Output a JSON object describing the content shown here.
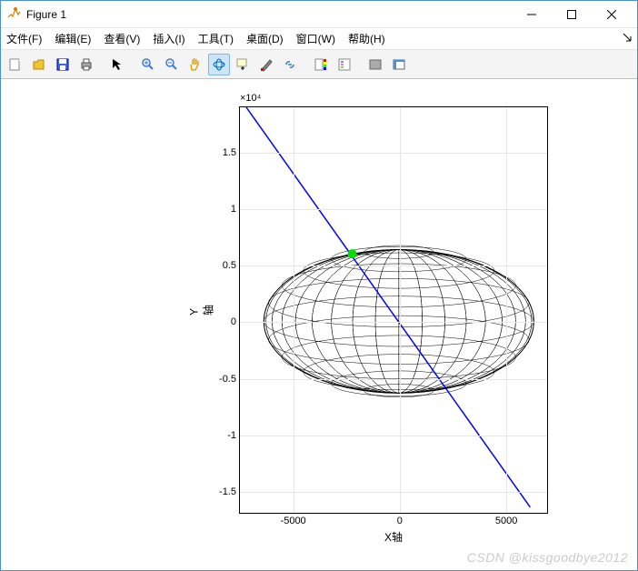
{
  "window": {
    "title": "Figure 1",
    "min_tooltip": "Minimize",
    "max_tooltip": "Maximize",
    "close_tooltip": "Close"
  },
  "menu": {
    "file": "文件(F)",
    "edit": "编辑(E)",
    "view": "查看(V)",
    "insert": "插入(I)",
    "tools": "工具(T)",
    "desktop": "桌面(D)",
    "window": "窗口(W)",
    "help": "帮助(H)"
  },
  "toolbar": {
    "new": "new-figure",
    "open": "open",
    "save": "save",
    "print": "print",
    "pointer": "edit-plot",
    "zoom_in": "zoom-in",
    "zoom_out": "zoom-out",
    "pan": "pan",
    "rotate3d": "rotate-3d",
    "datacursor": "data-cursor",
    "brush": "brush",
    "link": "link",
    "colorbar": "insert-colorbar",
    "legend": "insert-legend",
    "hide": "hide-plot-tools",
    "show": "show-plot-tools"
  },
  "chart_data": {
    "type": "line+surface",
    "title": "",
    "xlabel": "X轴",
    "ylabel": "Y轴",
    "exp_label": "×10⁴",
    "xlim": [
      -7500,
      7000
    ],
    "ylim": [
      -17000,
      19000
    ],
    "xticks": [
      -5000,
      0,
      5000
    ],
    "yticks": [
      -15000,
      -10000,
      -5000,
      0,
      5000,
      10000,
      15000
    ],
    "ytick_labels": [
      "-1.5",
      "-1",
      "-0.5",
      "0",
      "0.5",
      "1",
      "1.5"
    ],
    "line": {
      "points": [
        [
          -7200,
          19000
        ],
        [
          6200,
          -16500
        ]
      ],
      "color": "#0000ff"
    },
    "sphere": {
      "center": [
        0,
        0
      ],
      "radius": 6371,
      "wireframe_color": "#000000"
    },
    "marker": {
      "position": [
        -2200,
        6000
      ],
      "color": "#00e000",
      "size": 10
    }
  },
  "watermark": "CSDN @kissgoodbye2012"
}
